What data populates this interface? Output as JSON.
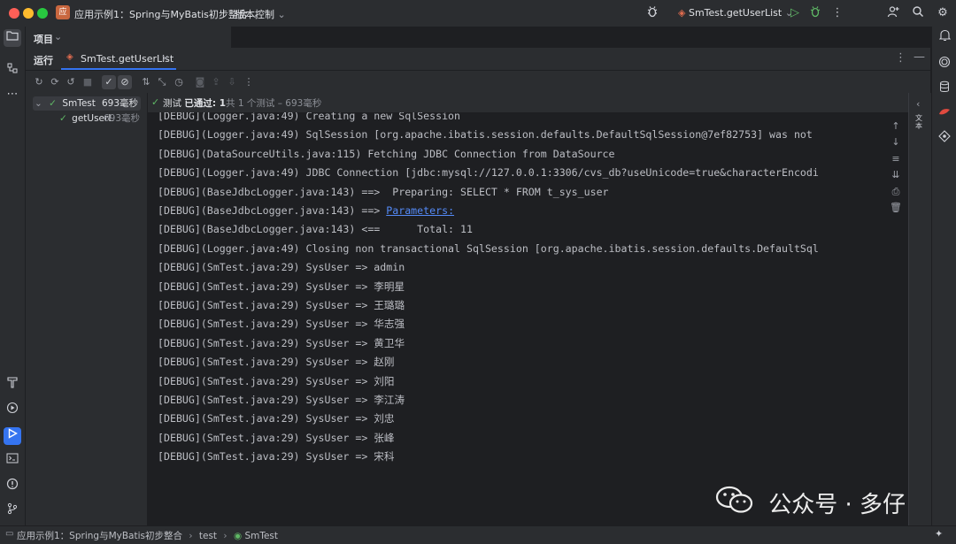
{
  "titlebar": {
    "project_badge": "应",
    "project_name": "应用示例1：Spring与MyBatis初步整合",
    "vcs_label": "版本控制",
    "run_config": "SmTest.getUserList",
    "dropdown_glyph": "⌄"
  },
  "project_strip": {
    "label": "项目"
  },
  "run_panel": {
    "title": "运行",
    "tab_label": "SmTest.getUserList"
  },
  "test_tree": {
    "root": {
      "name": "SmTest",
      "time": "693毫秒"
    },
    "child": {
      "name": "getUserL",
      "time": "693毫秒"
    }
  },
  "test_status": {
    "prefix": "测试",
    "passed": "已通过: 1",
    "detail": "共 1 个测试 – 693毫秒"
  },
  "console_lines": [
    {
      "text": "[DEBUG](Logger.java:49) Creating a new SqlSession"
    },
    {
      "text": "[DEBUG](Logger.java:49) SqlSession [org.apache.ibatis.session.defaults.DefaultSqlSession@7ef82753] was not"
    },
    {
      "text": "[DEBUG](DataSourceUtils.java:115) Fetching JDBC Connection from DataSource"
    },
    {
      "text": "[DEBUG](Logger.java:49) JDBC Connection [jdbc:mysql://127.0.0.1:3306/cvs_db?useUnicode=true&characterEncodi"
    },
    {
      "text": "[DEBUG](BaseJdbcLogger.java:143) ==>  Preparing: SELECT * FROM t_sys_user"
    },
    {
      "text": "[DEBUG](BaseJdbcLogger.java:143) ==> ",
      "link": "Parameters:"
    },
    {
      "text": "[DEBUG](BaseJdbcLogger.java:143) <==      Total: 11"
    },
    {
      "text": "[DEBUG](Logger.java:49) Closing non transactional SqlSession [org.apache.ibatis.session.defaults.DefaultSql"
    },
    {
      "text": "[DEBUG](SmTest.java:29) SysUser => admin"
    },
    {
      "text": "[DEBUG](SmTest.java:29) SysUser => 李明星"
    },
    {
      "text": "[DEBUG](SmTest.java:29) SysUser => 王璐璐"
    },
    {
      "text": "[DEBUG](SmTest.java:29) SysUser => 华志强"
    },
    {
      "text": "[DEBUG](SmTest.java:29) SysUser => 黄卫华"
    },
    {
      "text": "[DEBUG](SmTest.java:29) SysUser => 赵刚"
    },
    {
      "text": "[DEBUG](SmTest.java:29) SysUser => 刘阳"
    },
    {
      "text": "[DEBUG](SmTest.java:29) SysUser => 李江涛"
    },
    {
      "text": "[DEBUG](SmTest.java:29) SysUser => 刘忠"
    },
    {
      "text": "[DEBUG](SmTest.java:29) SysUser => 张峰"
    },
    {
      "text": "[DEBUG](SmTest.java:29) SysUser => 宋科"
    }
  ],
  "side_panel": {
    "label": "文本"
  },
  "statusbar": {
    "crumb_project": "应用示例1：Spring与MyBatis初步整合",
    "crumb_sep1": "›",
    "crumb_folder": "test",
    "crumb_sep2": "›",
    "crumb_class": "SmTest"
  },
  "watermark": {
    "text": "公众号 · 多仔"
  },
  "colors": {
    "background": "#1e1f22",
    "panel": "#2b2d30",
    "accent": "#3574f0",
    "pass_green": "#5fb865",
    "link": "#548af7",
    "close_red": "#ff5f57",
    "min_yellow": "#febc2e",
    "max_green": "#28c840"
  },
  "icons": {
    "folder": "folder-icon",
    "structure": "structure-icon",
    "more": "more-icon",
    "build": "hammer-icon",
    "services": "services-icon",
    "run": "run-icon",
    "terminal": "terminal-icon",
    "problems": "problems-icon",
    "git": "git-icon",
    "notifications": "bell-icon",
    "ai": "ai-spiral-icon",
    "database": "database-icon",
    "plugin": "plugin-icon",
    "settings": "gear-icon",
    "search": "search-icon",
    "add_user": "add-user-icon",
    "debug": "bug-icon"
  }
}
